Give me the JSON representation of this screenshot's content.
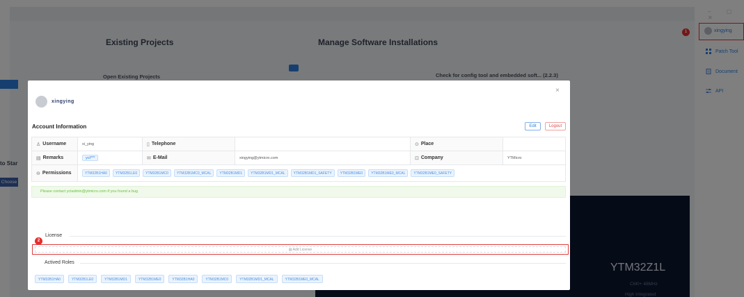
{
  "background": {
    "existing_projects_heading": "Existing Projects",
    "open_existing_label": "Open Existing Projects",
    "manage_heading": "Manage Software Installations",
    "check_config_label": "Check for config tool and embedded soft... (2.2.3)",
    "to_start_label": "to Star",
    "choose_label": "Choose",
    "chip_name": "YTM32Z1L",
    "chip_spec_1": "CM0+ 48MHz",
    "chip_spec_2": "High Integrated"
  },
  "right_panel": {
    "user_name": "xingying",
    "items": [
      {
        "label": "Patch Tool",
        "icon": "grid-icon"
      },
      {
        "label": "Document",
        "icon": "document-icon"
      },
      {
        "label": "API",
        "icon": "sliders-icon"
      }
    ],
    "badge_1": "1"
  },
  "modal": {
    "user_display_name": "xingying",
    "close_glyph": "×",
    "account_info_title": "Account Information",
    "edit_label": "Edit",
    "logout_label": "Logout",
    "labels": {
      "username": "Username",
      "telephone": "Telephone",
      "place": "Place",
      "remarks": "Remarks",
      "email": "E-Mail",
      "company": "Company",
      "permissions": "Permissions"
    },
    "values": {
      "username": "xi_ying",
      "telephone": "",
      "place": "",
      "remarks": "yct***",
      "email": "xingying@ytmicro.com",
      "company": "YTMicro"
    },
    "permissions": [
      "YTM32B1HA0",
      "YTM32B1LE0",
      "YTM32B1MC0",
      "YTM32B1MC0_MCAL",
      "YTM32B1MD1",
      "YTM32B1MD1_MCAL",
      "YTM32B1MD1_SAFETY",
      "YTM32B1ME0",
      "YTM32B1ME0_MCAL",
      "YTM32B1ME0_SAFETY"
    ],
    "alert_text": "Please contact yctadmin@ytmicro.com if you found a bug",
    "license_label": "License",
    "add_license_label": "Add License",
    "badge_2": "2",
    "actived_roles_label": "Actived Roles",
    "roles": [
      "YTM32B1HA0",
      "YTM32B1LE0",
      "YTM32B1MD1",
      "YTM32B1ME0",
      "YTM32B1HA0",
      "YTM32B1MC0",
      "YTM32B1MD1_MCAL",
      "YTM32B1ME0_MCAL"
    ]
  },
  "colors": {
    "accent": "#2d7fe0",
    "danger": "#e03b3b",
    "success_bg": "#f0f9eb",
    "dark_panel": "#0d1630"
  }
}
